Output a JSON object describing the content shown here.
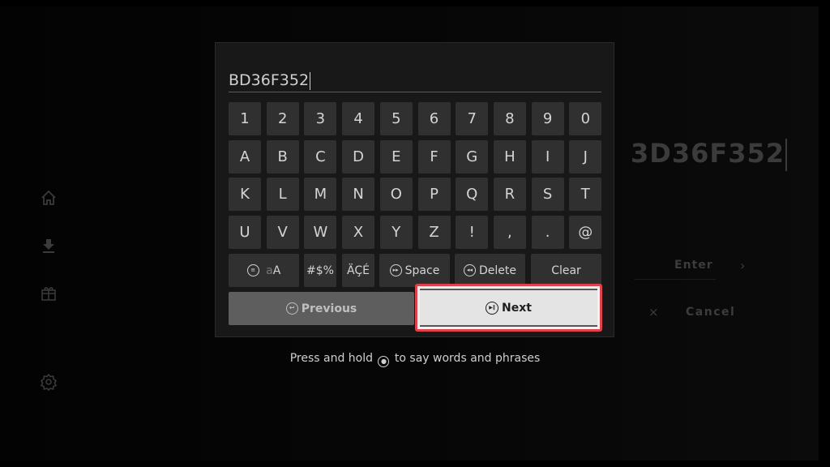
{
  "sidebar": {
    "items": [
      {
        "icon": "home-icon"
      },
      {
        "icon": "download-icon"
      },
      {
        "icon": "gift-icon"
      },
      {
        "icon": "gear-icon"
      }
    ]
  },
  "background": {
    "code": "3D36F352",
    "enter_label": "Enter",
    "chevron": "›",
    "cancel_icon": "×",
    "cancel_label": "Cancel"
  },
  "keyboard": {
    "input_value": "BD36F352",
    "rows": [
      [
        "1",
        "2",
        "3",
        "4",
        "5",
        "6",
        "7",
        "8",
        "9",
        "0"
      ],
      [
        "A",
        "B",
        "C",
        "D",
        "E",
        "F",
        "G",
        "H",
        "I",
        "J"
      ],
      [
        "K",
        "L",
        "M",
        "N",
        "O",
        "P",
        "Q",
        "R",
        "S",
        "T"
      ],
      [
        "U",
        "V",
        "W",
        "X",
        "Y",
        "Z",
        "!",
        ",",
        ".",
        "@"
      ]
    ],
    "function_keys": {
      "case_lower": "a",
      "case_upper": "A",
      "symbols": "#$%",
      "accents": "ÄÇÉ",
      "space": "Space",
      "delete": "Delete",
      "clear": "Clear"
    },
    "previous_label": "Previous",
    "next_label": "Next",
    "focus_color": "#e0424b"
  },
  "hint": {
    "before": "Press and hold",
    "after": "to say words and phrases"
  }
}
